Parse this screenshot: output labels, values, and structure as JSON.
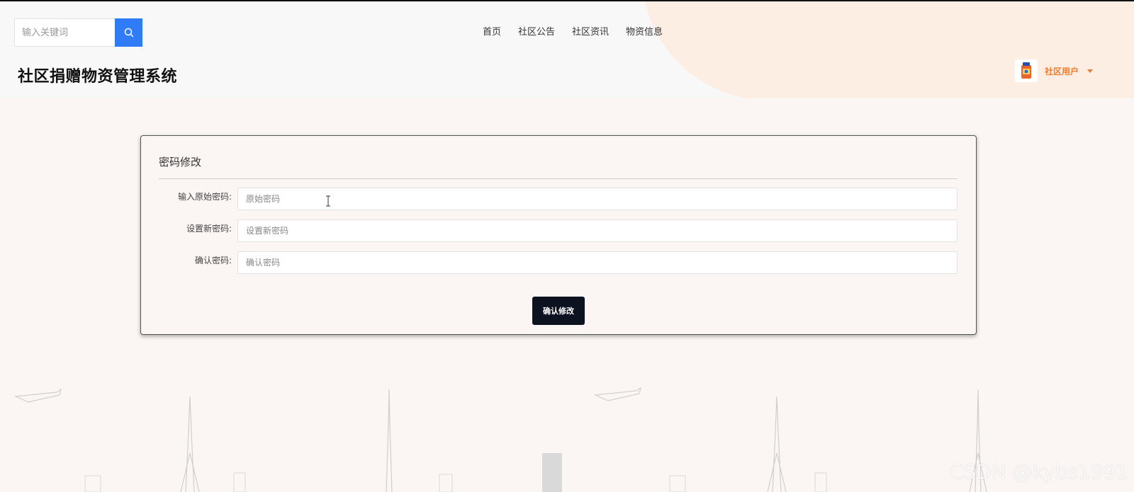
{
  "header": {
    "search_placeholder": "输入关键词",
    "site_title": "社区捐赠物资管理系统",
    "nav": [
      {
        "label": "首页"
      },
      {
        "label": "社区公告"
      },
      {
        "label": "社区资讯"
      },
      {
        "label": "物资信息"
      }
    ],
    "user": {
      "name": "社区用户",
      "avatar_icon": "user-avatar-icon"
    }
  },
  "form": {
    "title": "密码修改",
    "fields": [
      {
        "label": "输入原始密码:",
        "placeholder": "原始密码",
        "value": ""
      },
      {
        "label": "设置新密码:",
        "placeholder": "设置新密码",
        "value": ""
      },
      {
        "label": "确认密码:",
        "placeholder": "确认密码",
        "value": ""
      }
    ],
    "submit_label": "确认修改"
  },
  "watermark": "CSDN @kybs1991",
  "colors": {
    "accent": "#2f7cf6",
    "user_name": "#f07b2e",
    "submit_bg": "#0d1220"
  }
}
